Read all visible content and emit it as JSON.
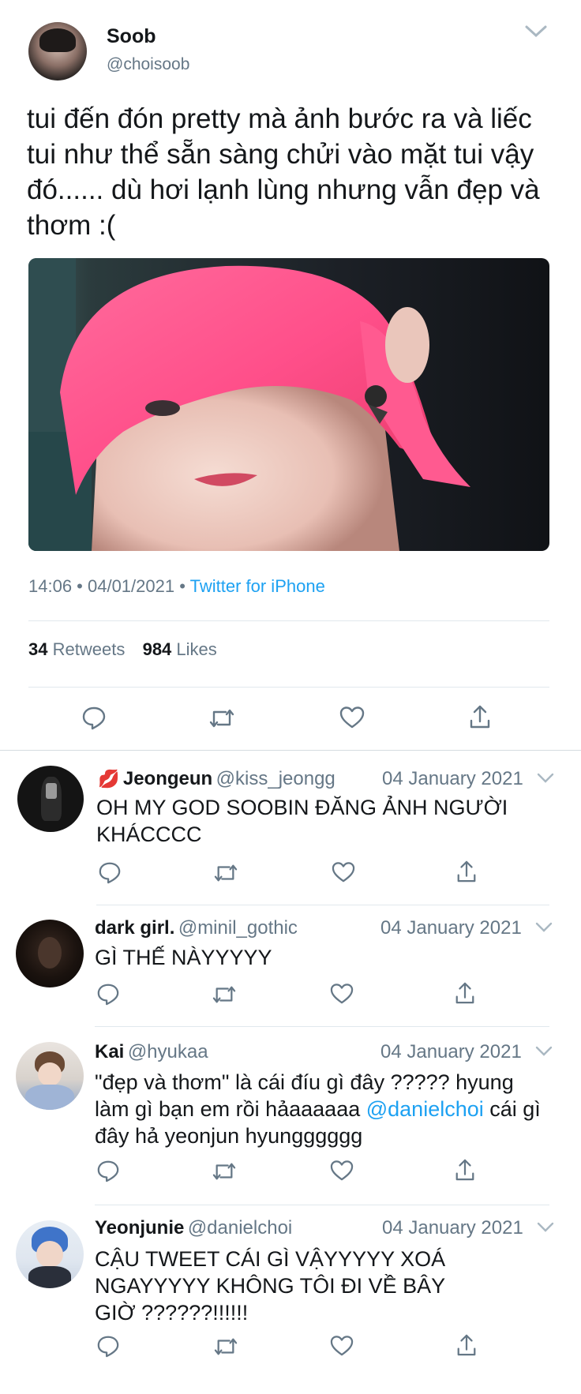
{
  "main_tweet": {
    "name": "Soob",
    "handle": "@choisoob",
    "text": "tui đến đón pretty mà ảnh bước ra và liếc tui như thể sẵn sàng chửi vào mặt tui vậy đó...... dù hơi lạnh lùng nhưng vẫn đẹp và thơm :(",
    "time": "14:06 • 04/01/2021 •",
    "source": "Twitter for iPhone",
    "retweets_count": "34",
    "retweets_label": "Retweets",
    "likes_count": "984",
    "likes_label": "Likes"
  },
  "replies": [
    {
      "emoji": "💋",
      "name": "Jeongeun",
      "handle": "@kiss_jeongg",
      "date": "04 January 2021",
      "text": "OH MY GOD SOOBIN ĐĂNG ẢNH NGƯỜI KHÁCCCC"
    },
    {
      "name": "dark girl.",
      "handle": "@minil_gothic",
      "date": "04 January 2021",
      "text": "GÌ THẾ NÀYYYYY"
    },
    {
      "name": "Kai",
      "handle": "@hyukaa",
      "date": "04 January 2021",
      "text_before": "\"đẹp và thơm\" là cái đíu gì đây ????? hyung làm gì bạn em rồi hảaaaaaa ",
      "mention": "@danielchoi",
      "text_after": " cái gì đây hả yeonjun hyungggggg"
    },
    {
      "name": "Yeonjunie",
      "handle": "@danielchoi",
      "date": "04 January 2021",
      "text": "CẬU TWEET CÁI GÌ VẬYYYYY XOÁ NGAYYYYY KHÔNG TÔI ĐI VỀ BÂY GIỜ ??????!!!!!!"
    }
  ],
  "colors": {
    "link": "#1da1f2",
    "muted": "#657786",
    "icon": "#657786",
    "separator": "#e1e8ed"
  },
  "icons": [
    "reply-icon",
    "retweet-icon",
    "like-icon",
    "share-icon",
    "chevron-down-icon"
  ]
}
